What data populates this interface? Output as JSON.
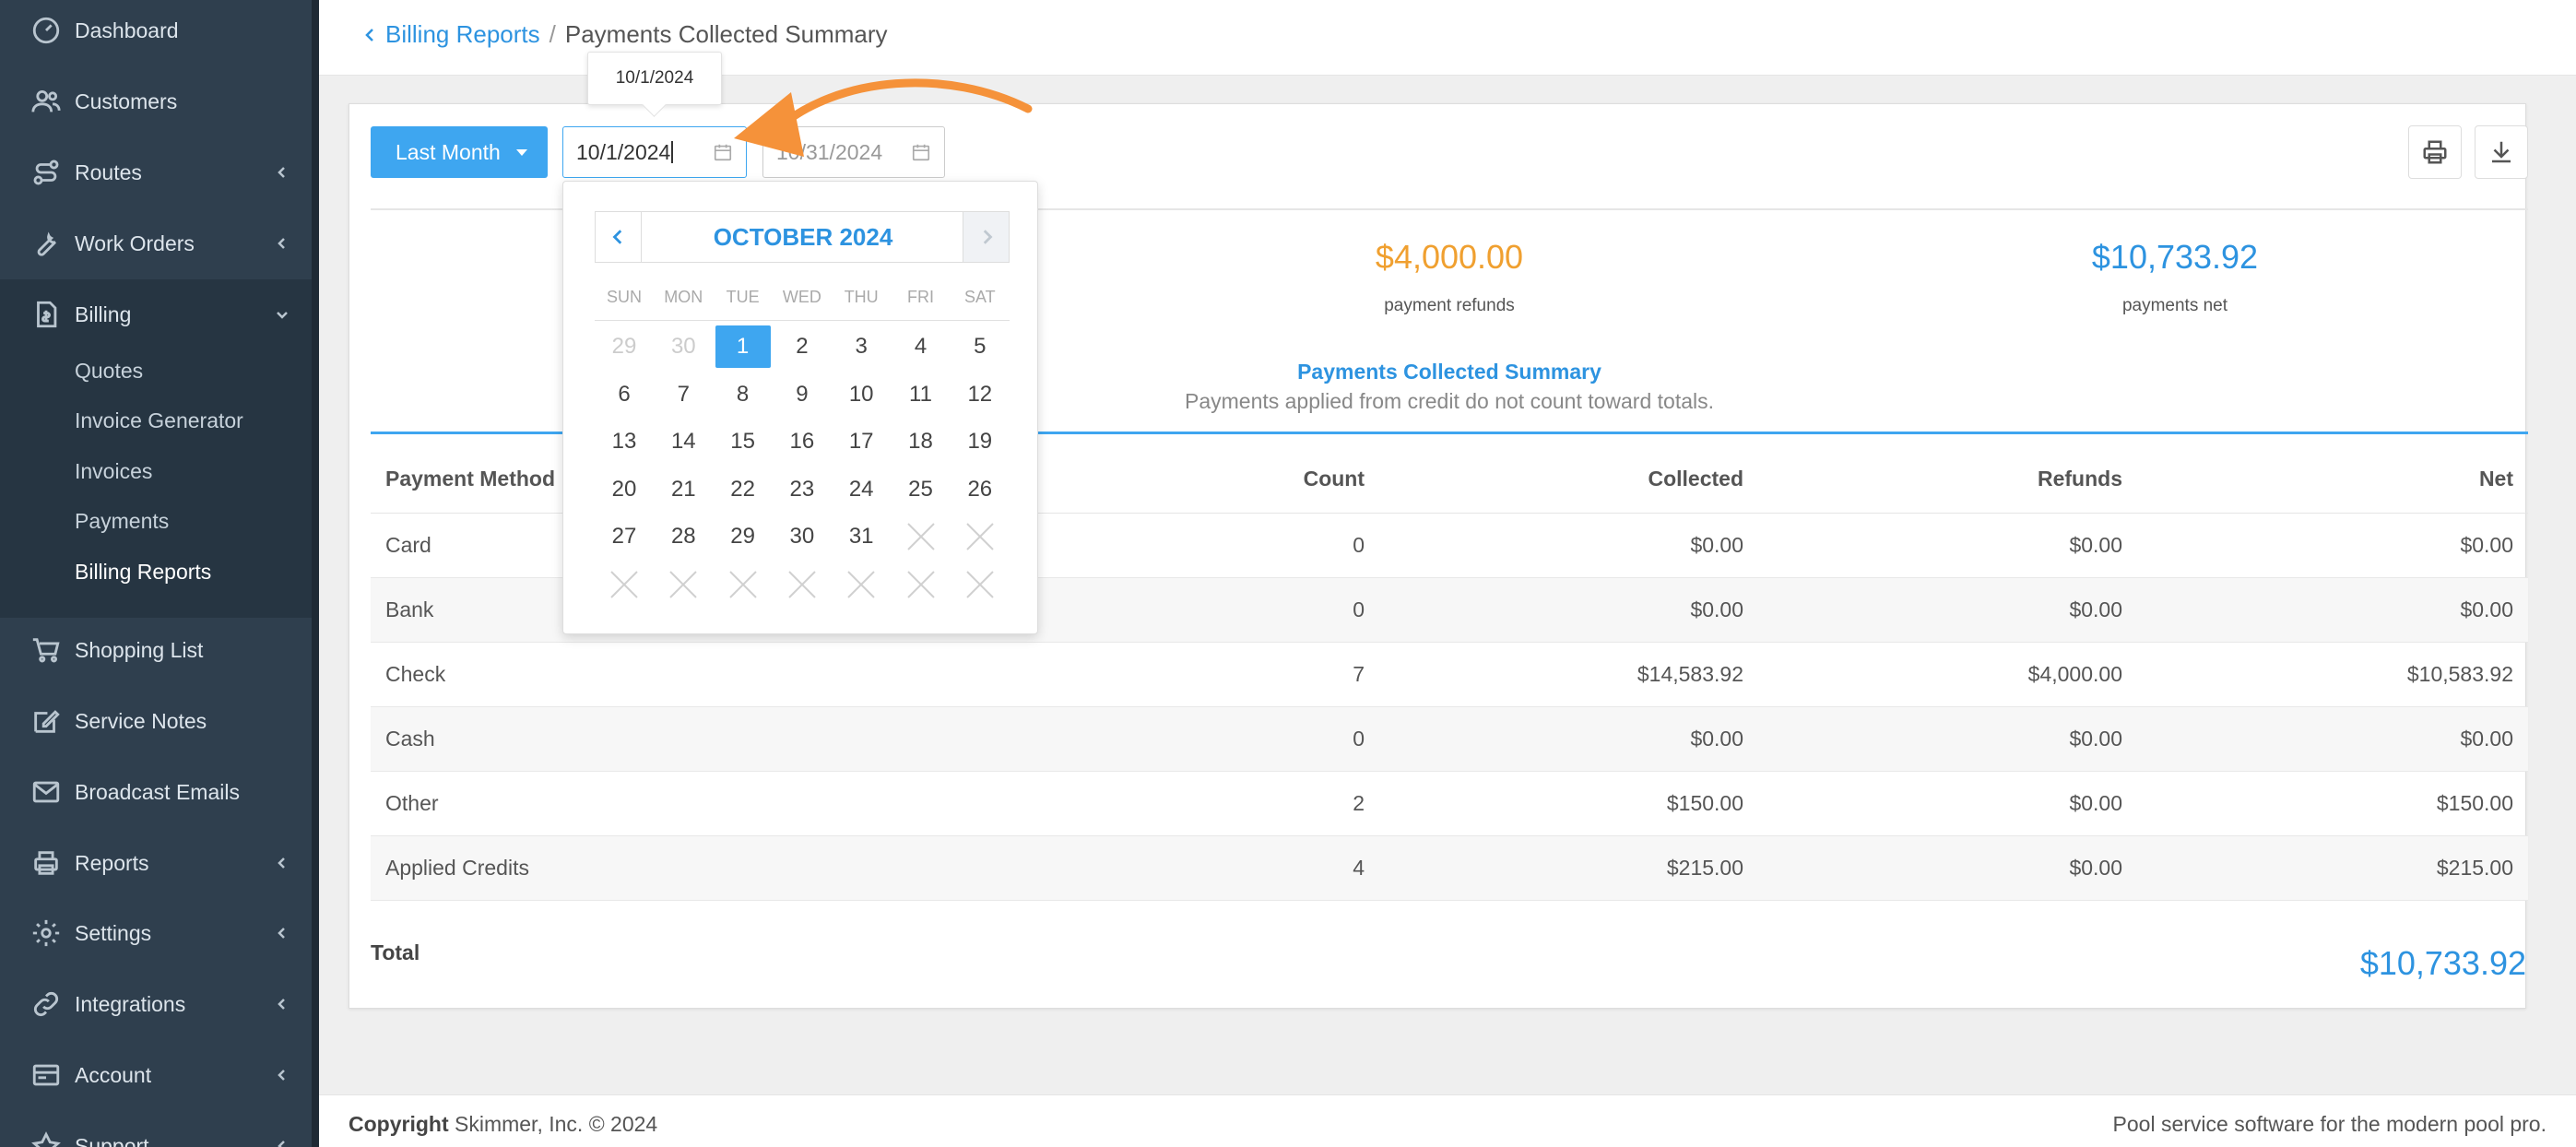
{
  "sidebar": {
    "items": [
      {
        "label": "Dashboard",
        "icon": "dashboard-icon"
      },
      {
        "label": "Customers",
        "icon": "customers-icon"
      },
      {
        "label": "Routes",
        "icon": "routes-icon"
      },
      {
        "label": "Work Orders",
        "icon": "wrench-icon"
      },
      {
        "label": "Billing",
        "icon": "billing-icon"
      },
      {
        "label": "Shopping List",
        "icon": "cart-icon"
      },
      {
        "label": "Service Notes",
        "icon": "edit-icon"
      },
      {
        "label": "Broadcast Emails",
        "icon": "envelope-icon"
      },
      {
        "label": "Reports",
        "icon": "printer-icon"
      },
      {
        "label": "Settings",
        "icon": "gear-icon"
      },
      {
        "label": "Integrations",
        "icon": "link-icon"
      },
      {
        "label": "Account",
        "icon": "account-icon"
      },
      {
        "label": "Support",
        "icon": "star-icon"
      }
    ],
    "billing_submenu": [
      "Quotes",
      "Invoice Generator",
      "Invoices",
      "Payments",
      "Billing Reports"
    ]
  },
  "breadcrumb": {
    "parent": "Billing Reports",
    "separator": "/",
    "current": "Payments Collected Summary"
  },
  "filters": {
    "range_label": "Last Month",
    "start_date": "10/1/2024",
    "end_date": "10/31/2024",
    "tooltip": "10/1/2024"
  },
  "stats": {
    "refunds_value": "$4,000.00",
    "refunds_label": "payment refunds",
    "net_value": "$10,733.92",
    "net_label": "payments net"
  },
  "summary": {
    "title": "Payments Collected Summary",
    "subtitle": "Payments applied from credit do not count toward totals."
  },
  "table": {
    "headers": [
      "Payment Method",
      "Count",
      "Collected",
      "Refunds",
      "Net"
    ],
    "rows": [
      [
        "Card",
        "0",
        "$0.00",
        "$0.00",
        "$0.00"
      ],
      [
        "Bank",
        "0",
        "$0.00",
        "$0.00",
        "$0.00"
      ],
      [
        "Check",
        "7",
        "$14,583.92",
        "$4,000.00",
        "$10,583.92"
      ],
      [
        "Cash",
        "0",
        "$0.00",
        "$0.00",
        "$0.00"
      ],
      [
        "Other",
        "2",
        "$150.00",
        "$0.00",
        "$150.00"
      ],
      [
        "Applied Credits",
        "4",
        "$215.00",
        "$0.00",
        "$215.00"
      ]
    ],
    "total_label": "Total",
    "total_value": "$10,733.92"
  },
  "datepicker": {
    "month_title": "OCTOBER 2024",
    "weekdays": [
      "SUN",
      "MON",
      "TUE",
      "WED",
      "THU",
      "FRI",
      "SAT"
    ],
    "weeks": [
      [
        "29",
        "30",
        "1",
        "2",
        "3",
        "4",
        "5"
      ],
      [
        "6",
        "7",
        "8",
        "9",
        "10",
        "11",
        "12"
      ],
      [
        "13",
        "14",
        "15",
        "16",
        "17",
        "18",
        "19"
      ],
      [
        "20",
        "21",
        "22",
        "23",
        "24",
        "25",
        "26"
      ],
      [
        "27",
        "28",
        "29",
        "30",
        "31",
        "",
        ""
      ],
      [
        "",
        "",
        "",
        "",
        "",
        "",
        ""
      ]
    ],
    "selected": "1"
  },
  "footer": {
    "copyright_bold": "Copyright",
    "copyright_rest": "Skimmer, Inc. © 2024",
    "tagline": "Pool service software for the modern pool pro."
  },
  "colors": {
    "accent": "#3ea6f0",
    "link": "#2d93e0",
    "refund": "#f0a030",
    "sidebar": "#2f3f4e",
    "annotation_arrow": "#f5923a"
  }
}
